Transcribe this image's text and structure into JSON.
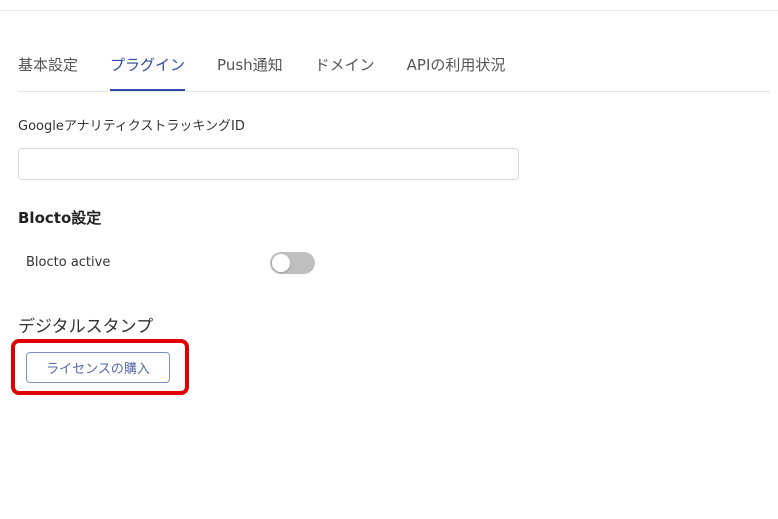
{
  "tabs": [
    {
      "label": "基本設定",
      "active": false
    },
    {
      "label": "プラグイン",
      "active": true
    },
    {
      "label": "Push通知",
      "active": false
    },
    {
      "label": "ドメイン",
      "active": false
    },
    {
      "label": "APIの利用状況",
      "active": false
    }
  ],
  "analytics": {
    "label": "GoogleアナリティクストラッキングID",
    "value": "",
    "placeholder": ""
  },
  "blocto": {
    "section_title": "Blocto設定",
    "toggle_label": "Blocto active",
    "enabled": false
  },
  "stamp": {
    "section_title": "デジタルスタンプ",
    "button_label": "ライセンスの購入"
  },
  "colors": {
    "accent": "#2f4aa0",
    "highlight": "#e00000",
    "toggle_off": "#bfbfbf"
  }
}
